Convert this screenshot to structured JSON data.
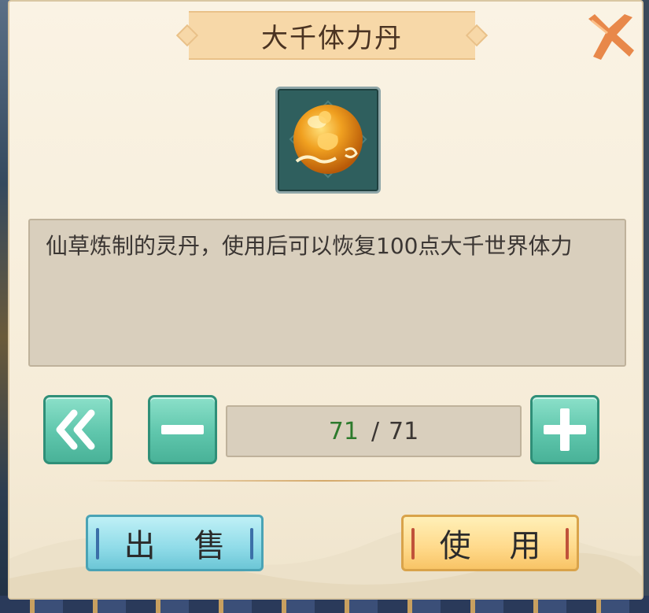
{
  "dialog": {
    "title": "大千体力丹",
    "item_icon": "golden-pill-orb-icon",
    "description": "仙草炼制的灵丹，使用后可以恢复100点大千世界体力",
    "quantity": {
      "current": "71",
      "separator": "/",
      "max": "71"
    },
    "buttons": {
      "first_icon": "double-chevron-left-icon",
      "minus_icon": "minus-icon",
      "plus_icon": "plus-icon",
      "close_icon": "close-x-icon",
      "sell": "出 售",
      "use": "使 用"
    }
  },
  "colors": {
    "panel": "#f6ecd8",
    "title_banner": "#f7d8a8",
    "stepper_button": "#5fc6ac",
    "sell_button": "#8fdbe8",
    "use_button": "#ffd98a",
    "close_icon": "#e8884a",
    "current_quantity": "#2c7a2c"
  }
}
